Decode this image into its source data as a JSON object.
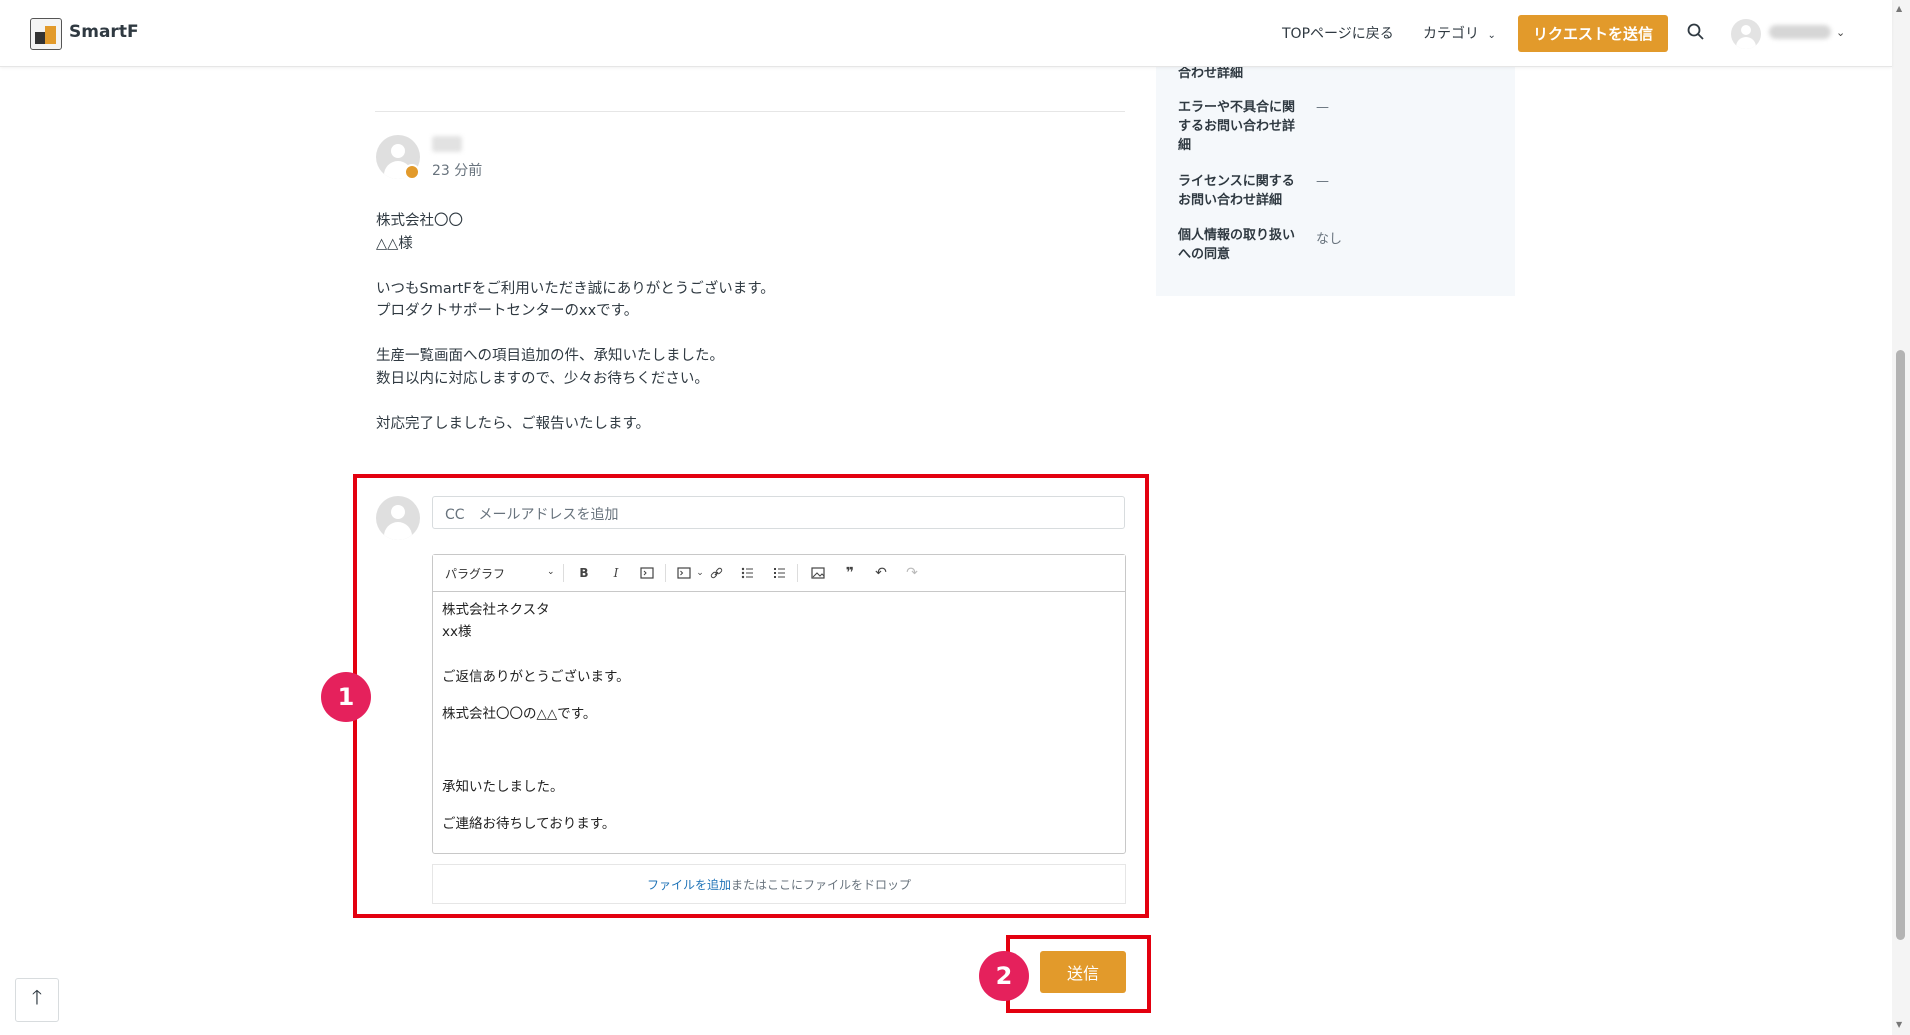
{
  "header": {
    "brand": "SmartF",
    "nav_top": "TOPページに戻る",
    "nav_category": "カテゴリ",
    "request_button": "リクエストを送信"
  },
  "sidebar_fields": [
    {
      "label": "合わせ詳細",
      "value": ""
    },
    {
      "label": "エラーや不具合に関するお問い合わせ詳細",
      "value": "—"
    },
    {
      "label": "ライセンスに関するお問い合わせ詳細",
      "value": "—"
    },
    {
      "label": "個人情報の取り扱いへの同意",
      "value": "なし"
    }
  ],
  "comment": {
    "time": "23 分前",
    "lines": {
      "company": "株式会社〇〇",
      "honorific": "△△様",
      "greeting": "いつもSmartFをご利用いただき誠にありがとうございます。",
      "intro": "プロダクトサポートセンターのxxです。",
      "ack": "生産一覧画面への項目追加の件、承知いたしました。",
      "wait": "数日以内に対応しますので、少々お待ちください。",
      "report": "対応完了しましたら、ご報告いたします。"
    }
  },
  "reply": {
    "cc_placeholder": "CC　メールアドレスを追加",
    "toolbar_format": "パラグラフ",
    "content": {
      "company": "株式会社ネクスタ",
      "honorific": "xx様",
      "thanks": "ご返信ありがとうございます。",
      "self_intro": "株式会社〇〇の△△です。",
      "ack": "承知いたしました。",
      "closing": "ご連絡お待ちしております。"
    },
    "file_link": "ファイルを追加",
    "file_rest": "またはここにファイルをドロップ",
    "send_button": "送信"
  },
  "callouts": {
    "one": "1",
    "two": "2"
  },
  "colors": {
    "accent": "#e29a2b",
    "callout_box": "#e3000f",
    "callout_badge": "#e5215c",
    "link": "#1f73b7"
  }
}
